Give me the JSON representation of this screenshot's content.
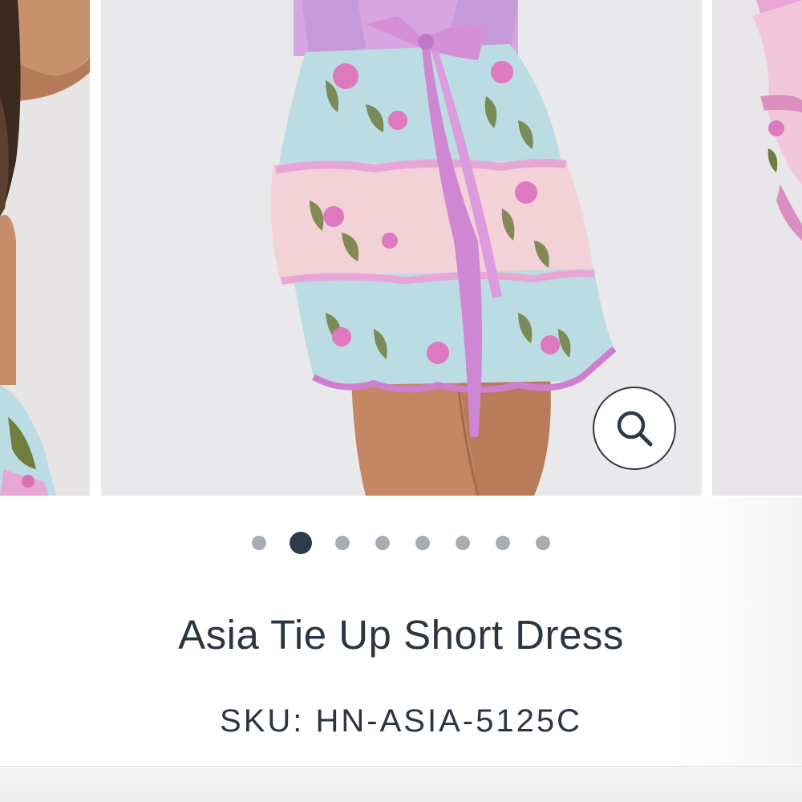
{
  "gallery": {
    "slides": [
      {
        "name": "previous-image",
        "description_icon": "product-photo"
      },
      {
        "name": "current-image",
        "description_icon": "product-photo"
      },
      {
        "name": "next-image",
        "description_icon": "product-photo"
      }
    ],
    "zoom_icon": "search-icon",
    "pagination": {
      "total": 8,
      "active_index": 1
    }
  },
  "product": {
    "title": "Asia Tie Up Short Dress",
    "sku_label": "SKU:",
    "sku_value": "HN-ASIA-5125C"
  },
  "colors": {
    "text": "#2c3642",
    "dot_active": "#2d3a4a",
    "dot_inactive": "#a7adb5",
    "photo_background": "#e9e8ea",
    "dress_pink": "#e7a6d6",
    "dress_blue": "#bcdce3"
  }
}
